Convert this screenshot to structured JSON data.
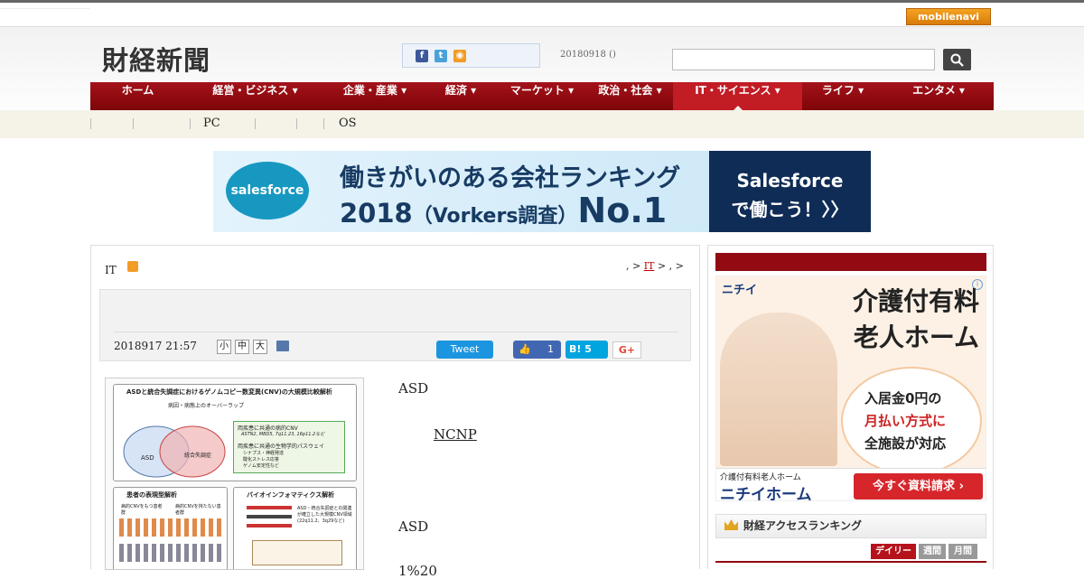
{
  "topbar": {
    "mobile_label": "mobilenavi"
  },
  "header": {
    "logo": "財経新聞",
    "date": "20180918 ()",
    "search_placeholder": ""
  },
  "nav": {
    "items": [
      {
        "label": "ホーム"
      },
      {
        "label": "経営・ビジネス ▾"
      },
      {
        "label": "企業・産業 ▾"
      },
      {
        "label": "経済 ▾"
      },
      {
        "label": "マーケット ▾"
      },
      {
        "label": "政治・社会 ▾"
      },
      {
        "label": "IT・サイエンス ▾"
      },
      {
        "label": "ライフ ▾"
      },
      {
        "label": "エンタメ ▾"
      }
    ]
  },
  "subnav": {
    "items": [
      "PC",
      "OS"
    ]
  },
  "banner": {
    "brand": "salesforce",
    "line1": "働きがいのある会社ランキング",
    "line2_year": "2018",
    "line2_mid": "（Vorkers調査）",
    "line2_no": "No.1",
    "right_line1": "Salesforce",
    "right_line2": "で働こう！〉〉"
  },
  "article": {
    "category": "IT",
    "breadcrumb_pre": ", >",
    "breadcrumb_link": "IT",
    "breadcrumb_post": "> , >",
    "date": "2018917 21:57",
    "font_sizes": [
      "小",
      "中",
      "大"
    ],
    "tweet_label": "Tweet",
    "like_count": "1",
    "hatena_label": "B! 5",
    "gplus_label": "G+",
    "para1": "ASD",
    "link_text": "NCNP",
    "para2": "ASD",
    "para3": "1%20"
  },
  "figure": {
    "title": "ASDと統合失調症におけるゲノムコピー数変異(CNV)の大規模比較解析",
    "sub1": "病因・病態上のオーバーラップ",
    "asd": "ASD",
    "scz": "統合失調症",
    "box1_title": "両疾患に共通の病的CNV",
    "box1_sub": "ASTN2, MBD5, 7q11.23, 16p11.2など",
    "box2_title": "両疾患に共通の生物学的パスウェイ",
    "box2_items": [
      "シナプス・神経発達",
      "酸化ストレス応答",
      "ゲノム安定性など"
    ],
    "panel1": "患者の表現型解析",
    "panel1_a": "病的CNVをもつ患者群",
    "panel1_b": "病的CNVを持たない患者群",
    "panel2": "バイオインフォマティクス解析",
    "panel2_text": "ASD・統合失調症との関連が確立した大規模CNV領域 (22q11.2、3q29など)"
  },
  "sidebar": {
    "ad_logo": "ニチイ",
    "ad_head1": "介護付有料",
    "ad_head2": "老人ホーム",
    "ad_circle1": "入居金0円の",
    "ad_circle2": "月払い方式に",
    "ad_circle3": "全施設が対応",
    "ad_small": "介護付有料老人ホーム",
    "ad_name": "ニチイホーム",
    "ad_btn": "今すぐ資料請求 ›",
    "ranking_title": "財経アクセスランキング",
    "tabs": [
      "デイリー",
      "週間",
      "月間"
    ]
  },
  "colors": {
    "nav": "#8e0b12",
    "accent": "#c21c25",
    "banner_right": "#0f2c56"
  }
}
